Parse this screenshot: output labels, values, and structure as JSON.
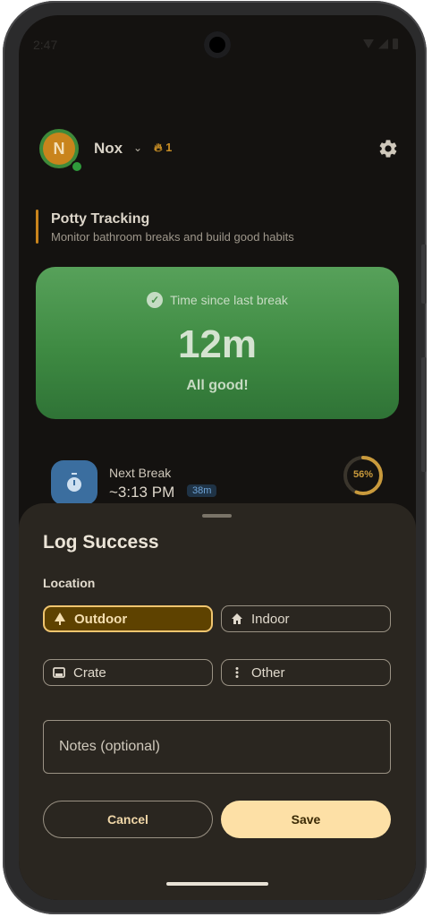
{
  "status_bar": {
    "time": "2:47"
  },
  "header": {
    "avatar_letter": "N",
    "pet_name": "Nox",
    "streak": "1"
  },
  "section": {
    "title": "Potty Tracking",
    "subtitle": "Monitor bathroom breaks and build good habits"
  },
  "status_card": {
    "label": "Time since last break",
    "value": "12m",
    "status": "All good!",
    "color": "#4a944d"
  },
  "next_break": {
    "label": "Next Break",
    "time": "~3:13 PM",
    "badge": "38m",
    "progress_percent": 56,
    "progress_label": "56%"
  },
  "sheet": {
    "title": "Log Success",
    "location_label": "Location",
    "locations": [
      {
        "label": "Outdoor",
        "icon": "tree-icon",
        "selected": true
      },
      {
        "label": "Indoor",
        "icon": "home-icon",
        "selected": false
      },
      {
        "label": "Crate",
        "icon": "crate-icon",
        "selected": false
      },
      {
        "label": "Other",
        "icon": "more-vert-icon",
        "selected": false
      }
    ],
    "notes_placeholder": "Notes (optional)",
    "cancel_label": "Cancel",
    "save_label": "Save"
  },
  "colors": {
    "accent": "#fde0a6",
    "selected_chip": "#5e4200",
    "brand_orange": "#c9841c"
  }
}
